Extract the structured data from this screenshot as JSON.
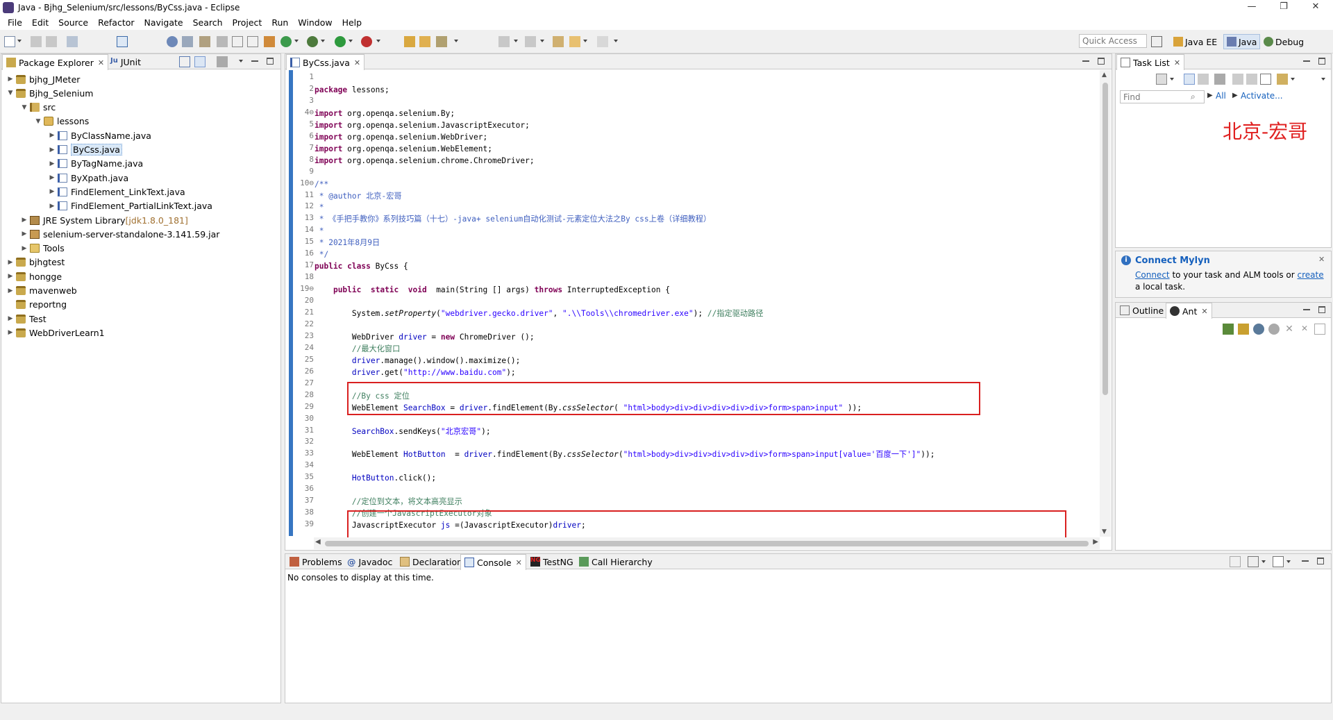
{
  "window": {
    "title": "Java - Bjhg_Selenium/src/lessons/ByCss.java - Eclipse",
    "controls": [
      "—",
      "❐",
      "✕"
    ]
  },
  "menu": [
    "File",
    "Edit",
    "Source",
    "Refactor",
    "Navigate",
    "Search",
    "Project",
    "Run",
    "Window",
    "Help"
  ],
  "toolbar": {
    "quick_access_placeholder": "Quick Access",
    "perspectives": [
      "Java EE",
      "Java",
      "Debug"
    ]
  },
  "package_explorer": {
    "tabs": [
      "Package Explorer",
      "JUnit"
    ],
    "tree": [
      {
        "label": "bjhg_JMeter",
        "icon": "project-icon",
        "depth": 0,
        "twisty": "collapsed"
      },
      {
        "label": "Bjhg_Selenium",
        "icon": "project-icon",
        "depth": 0,
        "twisty": "expanded"
      },
      {
        "label": "src",
        "icon": "source-folder-icon",
        "depth": 1,
        "twisty": "expanded"
      },
      {
        "label": "lessons",
        "icon": "package-icon",
        "depth": 2,
        "twisty": "expanded"
      },
      {
        "label": "ByClassName.java",
        "icon": "java-file-icon",
        "depth": 3,
        "twisty": "collapsed"
      },
      {
        "label": "ByCss.java",
        "icon": "java-file-icon",
        "depth": 3,
        "twisty": "collapsed",
        "selected": true
      },
      {
        "label": "ByTagName.java",
        "icon": "java-file-icon",
        "depth": 3,
        "twisty": "collapsed"
      },
      {
        "label": "ByXpath.java",
        "icon": "java-file-icon",
        "depth": 3,
        "twisty": "collapsed"
      },
      {
        "label": "FindElement_LinkText.java",
        "icon": "java-file-icon",
        "depth": 3,
        "twisty": "collapsed"
      },
      {
        "label": "FindElement_PartialLinkText.java",
        "icon": "java-file-icon",
        "depth": 3,
        "twisty": "collapsed"
      },
      {
        "label": "JRE System Library",
        "suffix": "[jdk1.8.0_181]",
        "icon": "library-icon",
        "depth": 1,
        "twisty": "collapsed"
      },
      {
        "label": "selenium-server-standalone-3.141.59.jar",
        "icon": "jar-icon",
        "depth": 1,
        "twisty": "collapsed"
      },
      {
        "label": "Tools",
        "icon": "folder-icon",
        "depth": 1,
        "twisty": "collapsed"
      },
      {
        "label": "bjhgtest",
        "icon": "project-icon",
        "depth": 0,
        "twisty": "collapsed"
      },
      {
        "label": "hongge",
        "icon": "project-icon",
        "depth": 0,
        "twisty": "collapsed"
      },
      {
        "label": "mavenweb",
        "icon": "project-icon",
        "depth": 0,
        "twisty": "collapsed"
      },
      {
        "label": "reportng",
        "icon": "project-icon",
        "depth": 0,
        "twisty": "none"
      },
      {
        "label": "Test",
        "icon": "project-icon",
        "depth": 0,
        "twisty": "collapsed"
      },
      {
        "label": "WebDriverLearn1",
        "icon": "project-icon",
        "depth": 0,
        "twisty": "collapsed"
      }
    ]
  },
  "editor": {
    "tab": "ByCss.java",
    "line_numbers": [
      "1",
      "2",
      "3",
      "4",
      "5",
      "6",
      "7",
      "8",
      "9",
      "10",
      "11",
      "12",
      "13",
      "14",
      "15",
      "16",
      "17",
      "18",
      "19",
      "20",
      "21",
      "22",
      "23",
      "24",
      "25",
      "26",
      "27",
      "28",
      "29",
      "30",
      "31",
      "32",
      "33",
      "34",
      "35",
      "36",
      "37",
      "38",
      "39"
    ],
    "fold_markers": {
      "4": "⊖",
      "10": "⊖",
      "19": "⊖"
    },
    "lines": [
      [],
      [
        [
          "k",
          "package"
        ],
        [
          "t",
          " lessons;"
        ]
      ],
      [],
      [
        [
          "k",
          "import"
        ],
        [
          "t",
          " org.openqa.selenium.By;"
        ]
      ],
      [
        [
          "k",
          "import"
        ],
        [
          "t",
          " org.openqa.selenium.JavascriptExecutor;"
        ]
      ],
      [
        [
          "k",
          "import"
        ],
        [
          "t",
          " org.openqa.selenium.WebDriver;"
        ]
      ],
      [
        [
          "k",
          "import"
        ],
        [
          "t",
          " org.openqa.selenium.WebElement;"
        ]
      ],
      [
        [
          "k",
          "import"
        ],
        [
          "t",
          " org.openqa.selenium.chrome.ChromeDriver;"
        ]
      ],
      [],
      [
        [
          "jd",
          "/**"
        ]
      ],
      [
        [
          "jd",
          " * "
        ],
        [
          "jd",
          "@author"
        ],
        [
          "jd",
          " 北京-宏哥"
        ]
      ],
      [
        [
          "jd",
          " *"
        ]
      ],
      [
        [
          "jd",
          " * 《手把手教你》系列技巧篇（十七）-java+ selenium自动化测试-元素定位大法之By css上卷（详细教程）"
        ]
      ],
      [
        [
          "jd",
          " *"
        ]
      ],
      [
        [
          "jd",
          " * 2021年8月9日"
        ]
      ],
      [
        [
          "jd",
          " */"
        ]
      ],
      [
        [
          "k",
          "public"
        ],
        [
          "t",
          " "
        ],
        [
          "k",
          "class"
        ],
        [
          "t",
          " ByCss {"
        ]
      ],
      [],
      [
        [
          "t",
          "    "
        ],
        [
          "k",
          "public"
        ],
        [
          "t",
          "  "
        ],
        [
          "k",
          "static"
        ],
        [
          "t",
          "  "
        ],
        [
          "k",
          "void"
        ],
        [
          "t",
          "  main(String [] args) "
        ],
        [
          "k",
          "throws"
        ],
        [
          "t",
          " InterruptedException {"
        ]
      ],
      [],
      [
        [
          "t",
          "        System."
        ],
        [
          "it",
          "setProperty"
        ],
        [
          "t",
          "("
        ],
        [
          "s",
          "\"webdriver.gecko.driver\""
        ],
        [
          "t",
          ", "
        ],
        [
          "s",
          "\".\\\\Tools\\\\chromedriver.exe\""
        ],
        [
          "t",
          "); "
        ],
        [
          "c",
          "//指定驱动路径"
        ]
      ],
      [],
      [
        [
          "t",
          "        WebDriver "
        ],
        [
          "f",
          "driver"
        ],
        [
          "t",
          " = "
        ],
        [
          "k",
          "new"
        ],
        [
          "t",
          " ChromeDriver ();"
        ]
      ],
      [
        [
          "c",
          "        //最大化窗口"
        ]
      ],
      [
        [
          "t",
          "        "
        ],
        [
          "f",
          "driver"
        ],
        [
          "t",
          ".manage().window().maximize();"
        ]
      ],
      [
        [
          "t",
          "        "
        ],
        [
          "f",
          "driver"
        ],
        [
          "t",
          ".get("
        ],
        [
          "s",
          "\"http://www.baidu.com\""
        ],
        [
          "t",
          ");"
        ]
      ],
      [],
      [
        [
          "c",
          "        //By css 定位"
        ]
      ],
      [
        [
          "t",
          "        WebElement "
        ],
        [
          "f",
          "SearchBox"
        ],
        [
          "t",
          " = "
        ],
        [
          "f",
          "driver"
        ],
        [
          "t",
          ".findElement(By."
        ],
        [
          "it",
          "cssSelector"
        ],
        [
          "t",
          "( "
        ],
        [
          "s",
          "\"html>body>div>div>div>div>div>form>span>input\""
        ],
        [
          "t",
          " ));"
        ]
      ],
      [],
      [
        [
          "t",
          "        "
        ],
        [
          "f",
          "SearchBox"
        ],
        [
          "t",
          ".sendKeys("
        ],
        [
          "s",
          "\"北京宏哥\""
        ],
        [
          "t",
          ");"
        ]
      ],
      [],
      [
        [
          "t",
          "        WebElement "
        ],
        [
          "f",
          "HotButton"
        ],
        [
          "t",
          "  = "
        ],
        [
          "f",
          "driver"
        ],
        [
          "t",
          ".findElement(By."
        ],
        [
          "it",
          "cssSelector"
        ],
        [
          "t",
          "("
        ],
        [
          "s",
          "\"html>body>div>div>div>div>div>form>span>input[value='百度一下']\""
        ],
        [
          "t",
          "));"
        ]
      ],
      [],
      [
        [
          "t",
          "        "
        ],
        [
          "f",
          "HotButton"
        ],
        [
          "t",
          ".click();"
        ]
      ],
      [],
      [
        [
          "c",
          "        //定位到文本，将文本高亮显示"
        ]
      ],
      [
        [
          "c",
          "        //创建一个JavascriptExecutor对象"
        ]
      ],
      [
        [
          "t",
          "        JavascriptExecutor "
        ],
        [
          "f",
          "js"
        ],
        [
          "t",
          " =(JavascriptExecutor)"
        ],
        [
          "f",
          "driver"
        ],
        [
          "t",
          ";"
        ]
      ]
    ]
  },
  "task_list": {
    "tab": "Task List",
    "find_placeholder": "Find",
    "all_label": "All",
    "activate_label": "Activate...",
    "watermark": "北京-宏哥"
  },
  "mylyn": {
    "title": "Connect Mylyn",
    "link1": "Connect",
    "text1": " to your task and ALM tools or ",
    "link2": "create",
    "text2": "a local task."
  },
  "outline": {
    "tabs": [
      "Outline",
      "Ant"
    ]
  },
  "bottom": {
    "tabs": [
      "Problems",
      "Javadoc",
      "Declaration",
      "Console",
      "TestNG",
      "Call Hierarchy"
    ],
    "console_message": "No consoles to display at this time."
  },
  "colors": {
    "keyword": "#7f0055",
    "string": "#2a00ff",
    "comment": "#3f7f5f",
    "javadoc": "#3f5fbf",
    "field": "#0000c0",
    "highlight_box": "#d92020",
    "watermark": "#e02020"
  }
}
